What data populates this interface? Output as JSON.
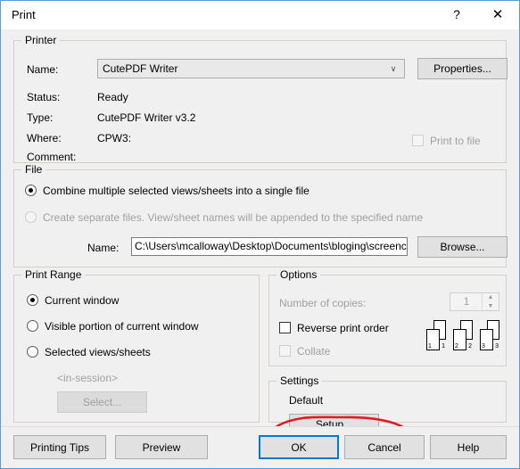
{
  "window": {
    "title": "Print",
    "help_label": "?",
    "close_label": "✕"
  },
  "printer": {
    "legend": "Printer",
    "name_label": "Name:",
    "name_value": "CutePDF Writer",
    "properties_label": "Properties...",
    "status_label": "Status:",
    "status_value": "Ready",
    "type_label": "Type:",
    "type_value": "CutePDF Writer v3.2",
    "where_label": "Where:",
    "where_value": "CPW3:",
    "comment_label": "Comment:",
    "comment_value": "",
    "print_to_file_label": "Print to file",
    "chevron": "∨"
  },
  "file": {
    "legend": "File",
    "combine_label": "Combine multiple selected views/sheets into a single file",
    "separate_label": "Create separate files. View/sheet names will be appended to the specified name",
    "name_label": "Name:",
    "name_value": "C:\\Users\\mcalloway\\Desktop\\Documents\\bloging\\screencasts\\printdpi",
    "browse_label": "Browse..."
  },
  "print_range": {
    "legend": "Print Range",
    "current_window_label": "Current window",
    "visible_portion_label": "Visible portion of current window",
    "selected_views_label": "Selected views/sheets",
    "in_session_label": "<in-session>",
    "select_label": "Select..."
  },
  "options": {
    "legend": "Options",
    "copies_label": "Number of copies:",
    "copies_value": "1",
    "spin_up": "▲",
    "spin_down": "▼",
    "reverse_label": "Reverse print order",
    "collate_label": "Collate",
    "collate_icons": [
      {
        "front": "1",
        "back": "1"
      },
      {
        "front": "2",
        "back": "2"
      },
      {
        "front": "3",
        "back": "3"
      }
    ]
  },
  "settings": {
    "legend": "Settings",
    "default_label": "Default",
    "setup_label": "Setup..."
  },
  "footer": {
    "printing_tips_label": "Printing Tips",
    "preview_label": "Preview",
    "ok_label": "OK",
    "cancel_label": "Cancel",
    "help_label": "Help"
  },
  "annotation": {
    "color": "#e01b24",
    "shape": "hand-drawn-ellipse"
  },
  "colors": {
    "dialog_background": "#f0f0f0",
    "window_border": "#5b9bd5",
    "focus_border": "#0078d7",
    "annotation_red": "#e01b24"
  }
}
